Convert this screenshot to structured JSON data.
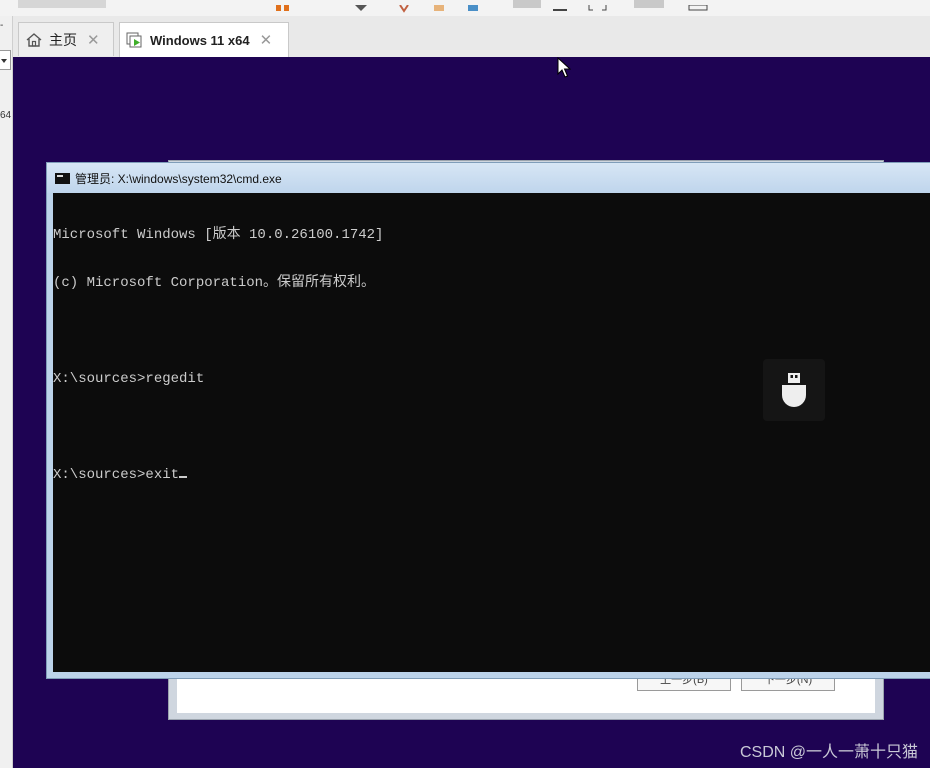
{
  "tabs": [
    {
      "label": "主页",
      "icon": "home-icon",
      "active": false
    },
    {
      "label": "Windows 11 x64",
      "icon": "vm-running-icon",
      "active": true
    }
  ],
  "left_strip": {
    "label_top": "-",
    "label_mid": "64"
  },
  "cmd": {
    "title": "管理员: X:\\windows\\system32\\cmd.exe",
    "lines": [
      "Microsoft Windows [版本 10.0.26100.1742]",
      "(c) Microsoft Corporation。保留所有权利。",
      "",
      "X:\\sources>regedit",
      "",
      "X:\\sources>exit"
    ]
  },
  "setup_dialog": {
    "back_button": "上一步(B)",
    "next_button": "下一步(N)"
  },
  "watermark": "CSDN @一人一萧十只猫",
  "colors": {
    "vm_background": "#1e0353",
    "console_background": "#0c0c0c",
    "console_text": "#cccccc",
    "titlebar": "#bfd5ec"
  }
}
